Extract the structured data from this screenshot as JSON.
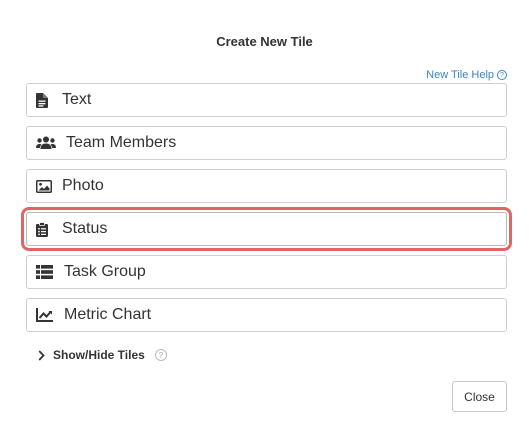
{
  "dialog": {
    "title": "Create New Tile",
    "help_link": "New Tile Help",
    "tiles": [
      {
        "label": "Text",
        "icon": "file-text-icon"
      },
      {
        "label": "Team Members",
        "icon": "users-icon"
      },
      {
        "label": "Photo",
        "icon": "image-icon"
      },
      {
        "label": "Status",
        "icon": "clipboard-icon",
        "highlighted": true
      },
      {
        "label": "Task Group",
        "icon": "list-icon"
      },
      {
        "label": "Metric Chart",
        "icon": "line-chart-icon"
      }
    ],
    "toggle_label": "Show/Hide Tiles",
    "close_label": "Close"
  },
  "colors": {
    "link": "#3b86c4",
    "highlight": "#e06666",
    "text": "#333333"
  }
}
